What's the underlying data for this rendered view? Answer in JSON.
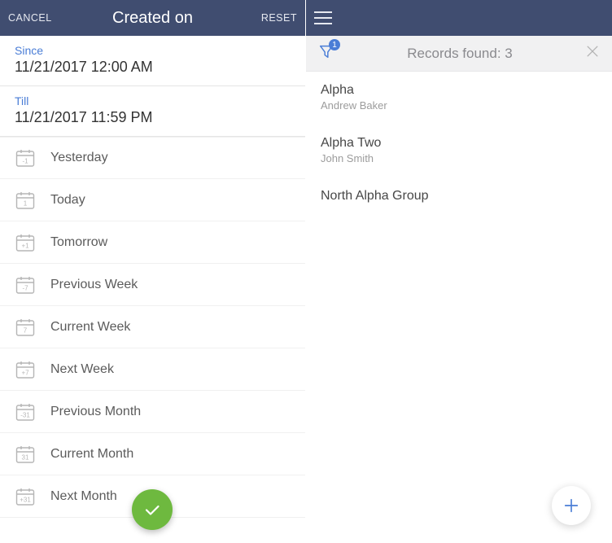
{
  "left": {
    "cancel": "CANCEL",
    "title": "Created on",
    "reset": "RESET",
    "since": {
      "label": "Since",
      "value": "11/21/2017 12:00 AM"
    },
    "till": {
      "label": "Till",
      "value": "11/21/2017 11:59 PM"
    },
    "presets": [
      {
        "label": "Yesterday",
        "icon_text": "-1"
      },
      {
        "label": "Today",
        "icon_text": "1"
      },
      {
        "label": "Tomorrow",
        "icon_text": "+1"
      },
      {
        "label": "Previous Week",
        "icon_text": "-7"
      },
      {
        "label": "Current Week",
        "icon_text": "7"
      },
      {
        "label": "Next Week",
        "icon_text": "+7"
      },
      {
        "label": "Previous Month",
        "icon_text": "-31"
      },
      {
        "label": "Current Month",
        "icon_text": "31"
      },
      {
        "label": "Next Month",
        "icon_text": "+31"
      }
    ]
  },
  "right": {
    "filter_badge": "1",
    "records_found_label": "Records found: 3",
    "records": [
      {
        "title": "Alpha",
        "subtitle": "Andrew Baker"
      },
      {
        "title": "Alpha Two",
        "subtitle": "John Smith"
      },
      {
        "title": "North Alpha Group",
        "subtitle": ""
      }
    ]
  },
  "colors": {
    "bar": "#404d70",
    "accent": "#4a7dd6",
    "confirm": "#6eb93f"
  }
}
